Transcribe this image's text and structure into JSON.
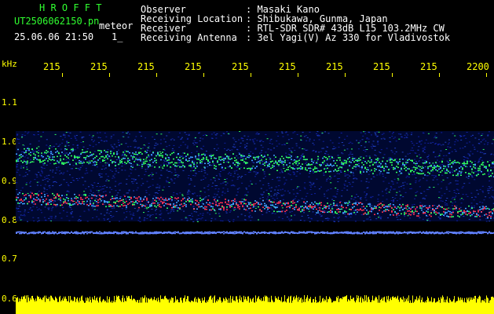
{
  "header": {
    "brand": "H R O F F T",
    "filename": "UT2506062150.pn",
    "mode": "meteor",
    "datetime": "25.06.06 21:50",
    "index": "1_"
  },
  "info": [
    {
      "label": "Observer",
      "value": ": Masaki Kano"
    },
    {
      "label": "Receiving Location",
      "value": ": Shibukawa, Gunma, Japan"
    },
    {
      "label": "Receiver",
      "value": ": RTL-SDR SDR# 43dB L15 103.2MHz CW"
    },
    {
      "label": "Receiving Antenna",
      "value": ": 3el Yagi(V) Az 330 for Vladivostok"
    }
  ],
  "chart_data": {
    "type": "heatmap",
    "x_axis": {
      "unit_label": "",
      "tick_labels": [
        "215",
        "215",
        "215",
        "215",
        "215",
        "215",
        "215",
        "215",
        "215",
        "2200"
      ]
    },
    "y_axis": {
      "unit_label": "kHz",
      "tick_labels": [
        "1.1",
        "1.0",
        "0.9",
        "0.8",
        "0.7",
        "0.6"
      ],
      "range": [
        0.6,
        1.1
      ]
    },
    "bands": [
      {
        "freq_start": 0.99,
        "freq_end": 0.95,
        "intensity": 0.9
      },
      {
        "freq_start": 0.875,
        "freq_end": 0.845,
        "intensity": 1.0
      },
      {
        "freq_start": 0.775,
        "freq_end": 0.77,
        "intensity": 0.5
      }
    ],
    "colors": {
      "background": "#000000",
      "signal_high": "#ff3050",
      "signal_mid": "#30ff60",
      "signal_low": "#1020a0",
      "axis": "#ffff00"
    }
  }
}
